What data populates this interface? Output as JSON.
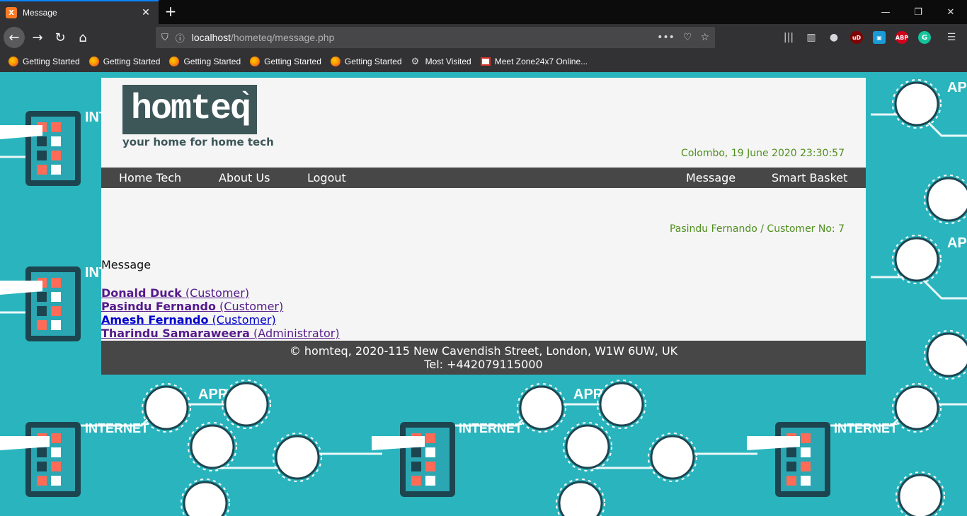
{
  "browser": {
    "tab_title": "Message",
    "tab_favicon": "X",
    "url_host": "localhost",
    "url_path": "/hometeq/message.php",
    "bookmarks": [
      {
        "label": "Getting Started",
        "icon": "firefox-icon"
      },
      {
        "label": "Getting Started",
        "icon": "firefox-icon"
      },
      {
        "label": "Getting Started",
        "icon": "firefox-icon"
      },
      {
        "label": "Getting Started",
        "icon": "firefox-icon"
      },
      {
        "label": "Getting Started",
        "icon": "firefox-icon"
      },
      {
        "label": "Most Visited",
        "icon": "gear-icon"
      },
      {
        "label": "Meet Zone24x7 Online...",
        "icon": "gmail-icon"
      }
    ],
    "extensions": {
      "ublock": "uD",
      "abp": "ABP",
      "grammarly": "G"
    }
  },
  "site": {
    "logo_text": "homteq",
    "logo_tick": "`",
    "tagline": "your home for home tech",
    "datetime": "Colombo, 19 June 2020 23:30:57"
  },
  "menu": {
    "left": [
      "Home Tech",
      "About Us",
      "Logout"
    ],
    "right": [
      "Message",
      "Smart Basket"
    ]
  },
  "user": {
    "line": "Pasindu Fernando / Customer No: 7"
  },
  "messages": {
    "title": "Message",
    "items": [
      {
        "name": "Donald Duck",
        "role": "(Customer)"
      },
      {
        "name": "Pasindu Fernando",
        "role": "(Customer)"
      },
      {
        "name": "Amesh Fernando",
        "role": "(Customer)"
      },
      {
        "name": "Tharindu Samaraweera",
        "role": "(Administrator)"
      }
    ]
  },
  "footer": {
    "line1": "© homteq, 2020-115 New Cavendish Street, London, W1W 6UW, UK",
    "line2": "Tel: +442079115000"
  },
  "colors": {
    "background": "#2ab5be",
    "panel": "#f5f5f5",
    "menubar": "#474747",
    "accent_green": "#4f8f1f",
    "logo_bg": "#3d5759"
  }
}
